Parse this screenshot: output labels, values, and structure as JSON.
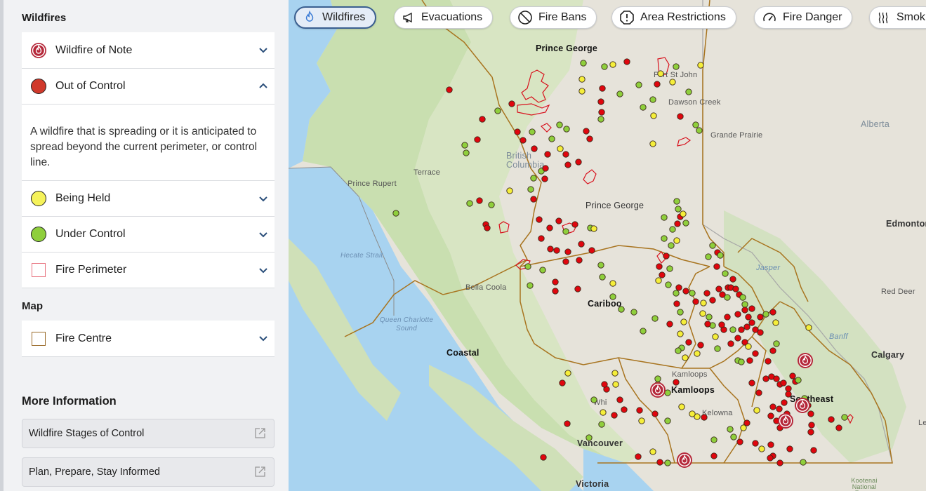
{
  "legend": {
    "wildfires_title": "Wildfires",
    "items": [
      {
        "label": "Wildfire of Note",
        "icon": "wildfire-of-note-icon"
      },
      {
        "label": "Out of Control",
        "icon": "out-of-control-dot",
        "color": "#d0392b"
      },
      {
        "label": "Being Held",
        "icon": "being-held-dot",
        "color": "#f5f25a"
      },
      {
        "label": "Under Control",
        "icon": "under-control-dot",
        "color": "#8fcf3c"
      },
      {
        "label": "Fire Perimeter",
        "icon": "fire-perimeter-square",
        "color": "#e8737f"
      }
    ],
    "out_of_control_description": "A wildfire that is spreading or it is anticipated to spread beyond the current perimeter, or control line.",
    "map_title": "Map",
    "map_items": [
      {
        "label": "Fire Centre",
        "icon": "fire-centre-square",
        "color": "#9a6b2a"
      }
    ]
  },
  "more_info": {
    "title": "More Information",
    "links": [
      {
        "label": "Wildfire Stages of Control"
      },
      {
        "label": "Plan, Prepare, Stay Informed"
      }
    ]
  },
  "pills": [
    {
      "label": "Wildfires",
      "icon": "flame-icon",
      "active": true
    },
    {
      "label": "Evacuations",
      "icon": "megaphone-icon"
    },
    {
      "label": "Fire Bans",
      "icon": "no-symbol-icon"
    },
    {
      "label": "Area Restrictions",
      "icon": "warning-octagon-icon"
    },
    {
      "label": "Fire Danger",
      "icon": "gauge-icon"
    },
    {
      "label": "Smok",
      "icon": "smoke-icon"
    }
  ],
  "map": {
    "places": {
      "prince_george_top": "Prince George",
      "fort_st_john": "Fort St John",
      "dawson_creek": "Dawson Creek",
      "grande_prairie": "Grande Prairie",
      "alberta": "Alberta",
      "terrace": "Terrace",
      "prince_rupert": "Prince Rupert",
      "british_columbia": "British Columbia",
      "prince_george": "Prince George",
      "edmonton": "Edmonton",
      "hecate_strait": "Hecate Strait",
      "jasper": "Jasper",
      "red_deer": "Red Deer",
      "bella_coola": "Bella Coola",
      "cariboo": "Cariboo",
      "queen_charlotte_sound": "Queen Charlotte Sound",
      "banff": "Banff",
      "coastal": "Coastal",
      "calgary": "Calgary",
      "kamloops_small": "Kamloops",
      "kamloops": "Kamloops",
      "southeast": "Southeast",
      "kelowna": "Kelowna",
      "whistler": "Whi",
      "vancouver": "Vancouver",
      "lethbridge": "Leth",
      "victoria": "Victoria",
      "kootenai": "Kootenai National Forest"
    }
  }
}
